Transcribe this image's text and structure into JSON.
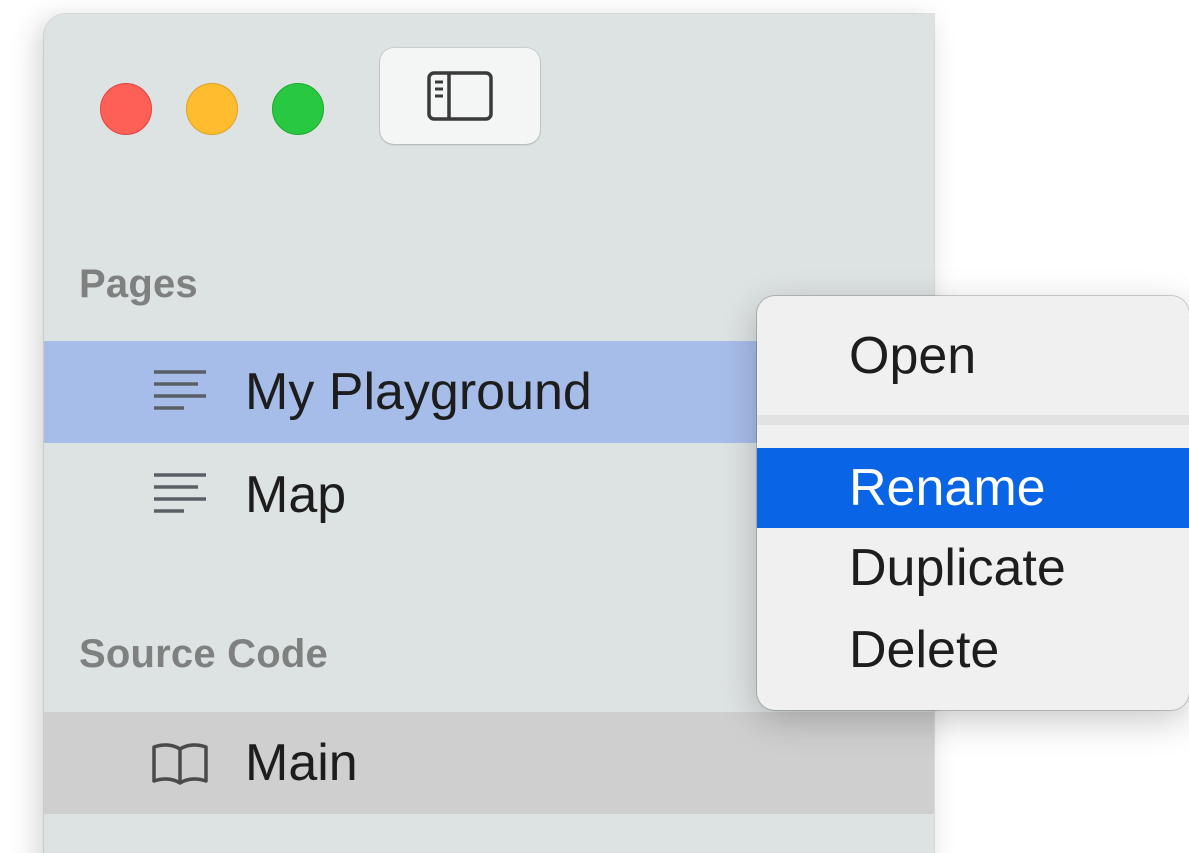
{
  "window": {
    "traffic_lights": [
      "close",
      "minimize",
      "zoom"
    ],
    "toolbar": {
      "sidebar_toggle_icon": "sidebar-toggle-icon"
    }
  },
  "sidebar": {
    "sections": [
      {
        "header": "Pages",
        "items": [
          {
            "label": "My Playground",
            "icon": "text-lines-icon",
            "state": "selected"
          },
          {
            "label": "Map",
            "icon": "text-lines-icon",
            "state": "normal"
          }
        ]
      },
      {
        "header": "Source Code",
        "items": [
          {
            "label": "Main",
            "icon": "book-icon",
            "state": "hover"
          }
        ]
      }
    ]
  },
  "context_menu": {
    "items": [
      {
        "label": "Open"
      },
      {
        "label": "Rename",
        "highlighted": true
      },
      {
        "label": "Duplicate"
      },
      {
        "label": "Delete"
      }
    ]
  },
  "colors": {
    "sidebar_bg": "#dde2e2",
    "selection": "#a7bde9",
    "menu_highlight": "#0a64e6",
    "close": "#fe5f57",
    "minimize": "#febc2e",
    "zoom": "#28c840"
  }
}
